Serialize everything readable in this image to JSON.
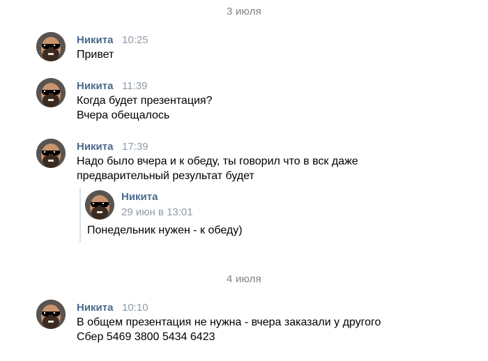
{
  "dates": [
    "3 июля",
    "4 июля"
  ],
  "messages": [
    {
      "author": "Никита",
      "time": "10:25",
      "lines": [
        "Привет"
      ]
    },
    {
      "author": "Никита",
      "time": "11:39",
      "lines": [
        "Когда будет презентация?",
        "Вчера обещалось"
      ]
    },
    {
      "author": "Никита",
      "time": "17:39",
      "lines": [
        "Надо было вчера и к обеду, ты говорил что в вск даже",
        "предварительный результат будет"
      ],
      "quote": {
        "author": "Никита",
        "date": "29 июн в 13:01",
        "text": "Понедельник нужен - к обеду)"
      }
    },
    {
      "author": "Никита",
      "time": "10:10",
      "lines": [
        "В общем презентация не нужна - вчера заказали у другого",
        "Сбер 5469 3800 5434 6423"
      ]
    }
  ],
  "colors": {
    "author": "#4a6a8f",
    "time": "#8f9aa6",
    "date_separator": "#828282",
    "quote_bar": "#d8e0ea"
  },
  "icons": {
    "avatar": "avatar-sunglasses-icon"
  }
}
